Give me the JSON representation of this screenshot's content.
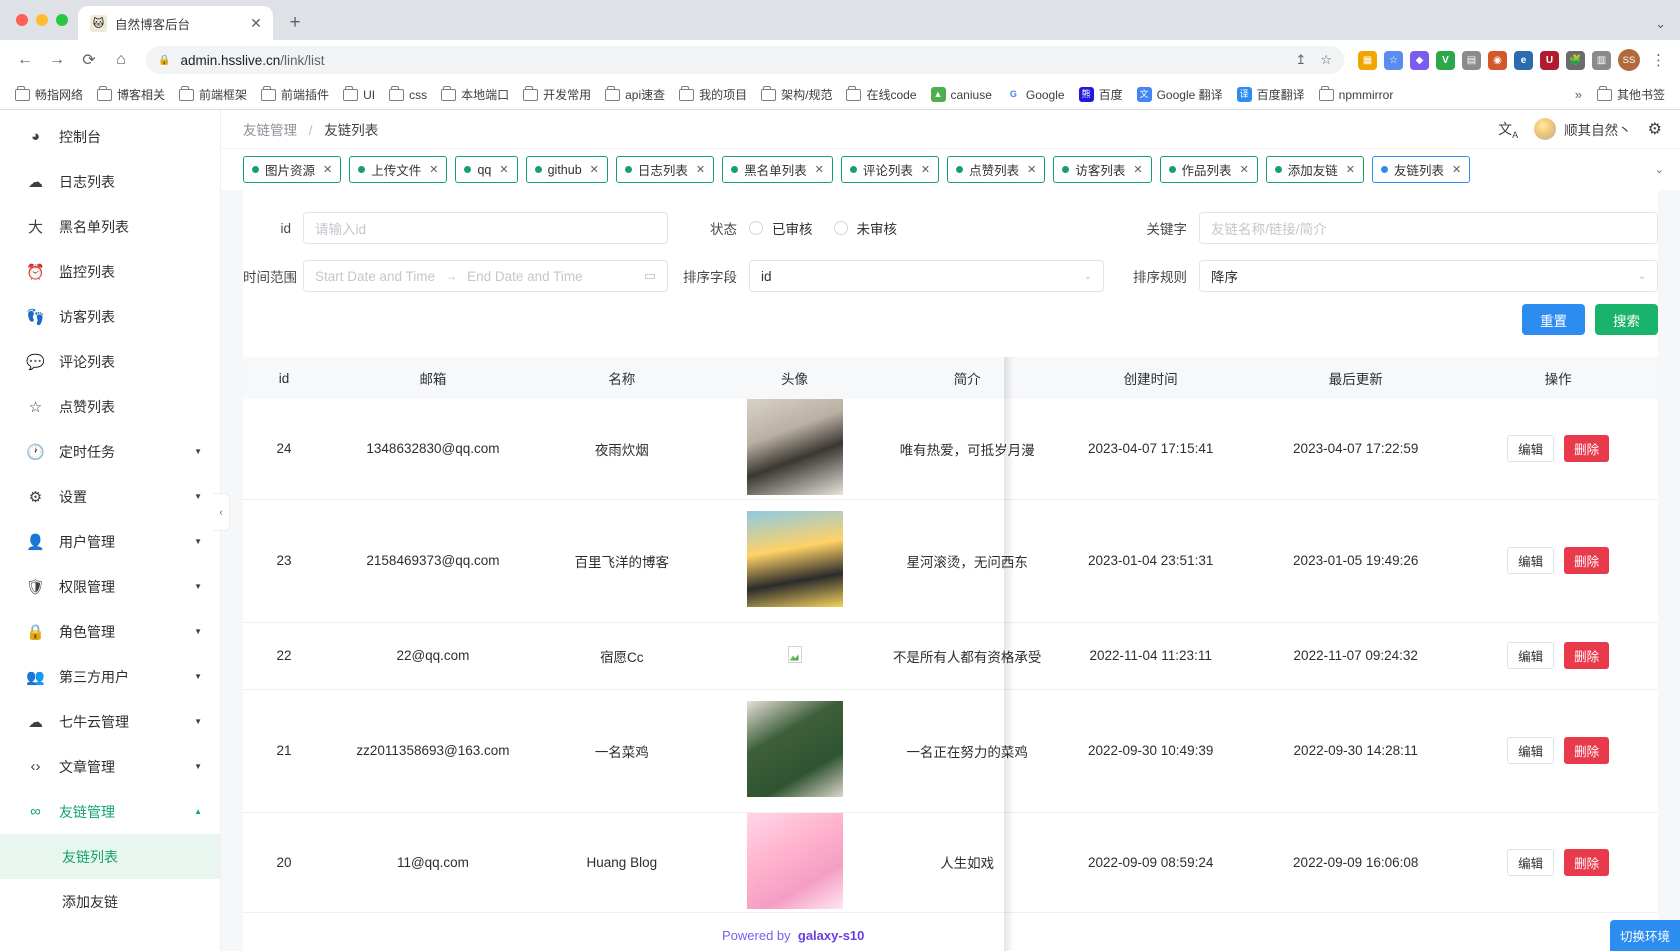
{
  "browser": {
    "tab_title": "自然博客后台",
    "tab_close": "✕",
    "new_tab": "+",
    "window_chevron": "⌄",
    "back": "←",
    "forward": "→",
    "reload": "⟳",
    "home": "⌂",
    "lock": "🔒",
    "url_host": "admin.hsslive.cn",
    "url_path": "/link/list",
    "share": "↥",
    "star": "☆",
    "kebab": "⋮",
    "profile_initials": "SS",
    "bookmarks": [
      {
        "label": "畅指网络",
        "icon": "folder-icon"
      },
      {
        "label": "博客相关",
        "icon": "folder-icon"
      },
      {
        "label": "前端框架",
        "icon": "folder-icon"
      },
      {
        "label": "前端插件",
        "icon": "folder-icon"
      },
      {
        "label": "UI",
        "icon": "folder-icon"
      },
      {
        "label": "css",
        "icon": "folder-icon"
      },
      {
        "label": "本地端口",
        "icon": "folder-icon"
      },
      {
        "label": "开发常用",
        "icon": "folder-icon"
      },
      {
        "label": "api速查",
        "icon": "folder-icon"
      },
      {
        "label": "我的项目",
        "icon": "folder-icon"
      },
      {
        "label": "架构/规范",
        "icon": "folder-icon"
      },
      {
        "label": "在线code",
        "icon": "folder-icon"
      },
      {
        "label": "caniuse",
        "icon": "caniuse-icon"
      },
      {
        "label": "Google",
        "icon": "google-icon"
      },
      {
        "label": "百度",
        "icon": "baidu-icon"
      },
      {
        "label": "Google 翻译",
        "icon": "google-translate-icon"
      },
      {
        "label": "百度翻译",
        "icon": "baidu-translate-icon"
      },
      {
        "label": "npmmirror",
        "icon": "folder-icon"
      }
    ],
    "bookmarks_overflow": "»",
    "other_bookmarks": "其他书签"
  },
  "sidebar": {
    "items": [
      {
        "label": "控制台",
        "icon": "dashboard-icon",
        "expandable": false
      },
      {
        "label": "日志列表",
        "icon": "cloud-icon",
        "expandable": false
      },
      {
        "label": "黑名单列表",
        "icon": "person-icon",
        "expandable": false
      },
      {
        "label": "监控列表",
        "icon": "alarm-icon",
        "expandable": false
      },
      {
        "label": "访客列表",
        "icon": "footprint-icon",
        "expandable": false
      },
      {
        "label": "评论列表",
        "icon": "comment-icon",
        "expandable": false
      },
      {
        "label": "点赞列表",
        "icon": "star-icon",
        "expandable": false
      },
      {
        "label": "定时任务",
        "icon": "clock-icon",
        "expandable": true
      },
      {
        "label": "设置",
        "icon": "gear-icon",
        "expandable": true
      },
      {
        "label": "用户管理",
        "icon": "user-icon",
        "expandable": true
      },
      {
        "label": "权限管理",
        "icon": "shield-icon",
        "expandable": true
      },
      {
        "label": "角色管理",
        "icon": "lock-icon",
        "expandable": true
      },
      {
        "label": "第三方用户",
        "icon": "users-icon",
        "expandable": true
      },
      {
        "label": "七牛云管理",
        "icon": "cloud-download-icon",
        "expandable": true
      },
      {
        "label": "文章管理",
        "icon": "code-icon",
        "expandable": true
      },
      {
        "label": "友链管理",
        "icon": "infinity-icon",
        "expandable": true,
        "active": true
      }
    ],
    "sub_items": [
      {
        "label": "友链列表",
        "active": true
      },
      {
        "label": "添加友链",
        "active": false
      }
    ],
    "caret_down": "▼",
    "caret_up": "▲",
    "collapse_handle": "‹"
  },
  "header": {
    "breadcrumb_parent": "友链管理",
    "breadcrumb_sep": "/",
    "breadcrumb_current": "友链列表",
    "lang_icon": "translate-icon",
    "username": "顺其自然丶",
    "gear_icon": "gear-icon"
  },
  "tabchips": {
    "items": [
      {
        "label": "图片资源",
        "color": "green"
      },
      {
        "label": "上传文件",
        "color": "green"
      },
      {
        "label": "qq",
        "color": "green"
      },
      {
        "label": "github",
        "color": "green"
      },
      {
        "label": "日志列表",
        "color": "green"
      },
      {
        "label": "黑名单列表",
        "color": "green"
      },
      {
        "label": "评论列表",
        "color": "green"
      },
      {
        "label": "点赞列表",
        "color": "green"
      },
      {
        "label": "访客列表",
        "color": "green"
      },
      {
        "label": "作品列表",
        "color": "green"
      },
      {
        "label": "添加友链",
        "color": "green"
      },
      {
        "label": "友链列表",
        "color": "blue"
      }
    ],
    "close_glyph": "✕",
    "overflow_caret": "⌄"
  },
  "filters": {
    "id_label": "id",
    "id_placeholder": "请输入id",
    "id_value": "",
    "status_label": "状态",
    "status_options": [
      "已审核",
      "未审核"
    ],
    "keyword_label": "关键字",
    "keyword_placeholder": "友链名称/链接/简介",
    "keyword_value": "",
    "daterange_label": "时间范围",
    "start_placeholder": "Start Date and Time",
    "range_arrow": "→",
    "end_placeholder": "End Date and Time",
    "calendar_icon": "calendar-icon",
    "sortfield_label": "排序字段",
    "sortfield_value": "id",
    "sortrule_label": "排序规则",
    "sortrule_value": "降序",
    "reset_label": "重置",
    "search_label": "搜索"
  },
  "table": {
    "columns": [
      "id",
      "邮箱",
      "名称",
      "头像",
      "简介",
      "创建时间",
      "最后更新",
      "操作"
    ],
    "rows": [
      {
        "id": "24",
        "email": "1348632830@qq.com",
        "name": "夜雨炊烟",
        "avatar": "avatar-ink-painting",
        "desc": "唯有热爱，可抵岁月漫",
        "created": "2023-04-07 17:15:41",
        "updated": "2023-04-07 17:22:59",
        "edit": "编辑",
        "delete": "删除"
      },
      {
        "id": "23",
        "email": "2158469373@qq.com",
        "name": "百里飞洋的博客",
        "avatar": "avatar-person-photo",
        "desc": "星河滚烫，无问西东",
        "created": "2023-01-04 23:51:31",
        "updated": "2023-01-05 19:49:26",
        "edit": "编辑",
        "delete": "删除"
      },
      {
        "id": "22",
        "email": "22@qq.com",
        "name": "宿愿Cc",
        "avatar": "avatar-broken-image",
        "desc": "不是所有人都有资格承受",
        "created": "2022-11-04 11:23:11",
        "updated": "2022-11-07 09:24:32",
        "edit": "编辑",
        "delete": "删除"
      },
      {
        "id": "21",
        "email": "zz2011358693@163.com",
        "name": "一名菜鸡",
        "avatar": "avatar-green-hoodie",
        "desc": "一名正在努力的菜鸡",
        "created": "2022-09-30 10:49:39",
        "updated": "2022-09-30 14:28:11",
        "edit": "编辑",
        "delete": "删除"
      },
      {
        "id": "20",
        "email": "11@qq.com",
        "name": "Huang Blog",
        "avatar": "avatar-pink-anime",
        "desc": "人生如戏",
        "created": "2022-09-09 08:59:24",
        "updated": "2022-09-09 16:06:08",
        "edit": "编辑",
        "delete": "删除"
      }
    ]
  },
  "overlay": {
    "watermark_prefix": "Powered by",
    "watermark_name": "galaxy-s10",
    "env_button": "切换环境"
  },
  "colors": {
    "green": "#12a36b",
    "blue": "#2d8cf0",
    "red": "#e83a4b",
    "search_green": "#19b36b"
  }
}
